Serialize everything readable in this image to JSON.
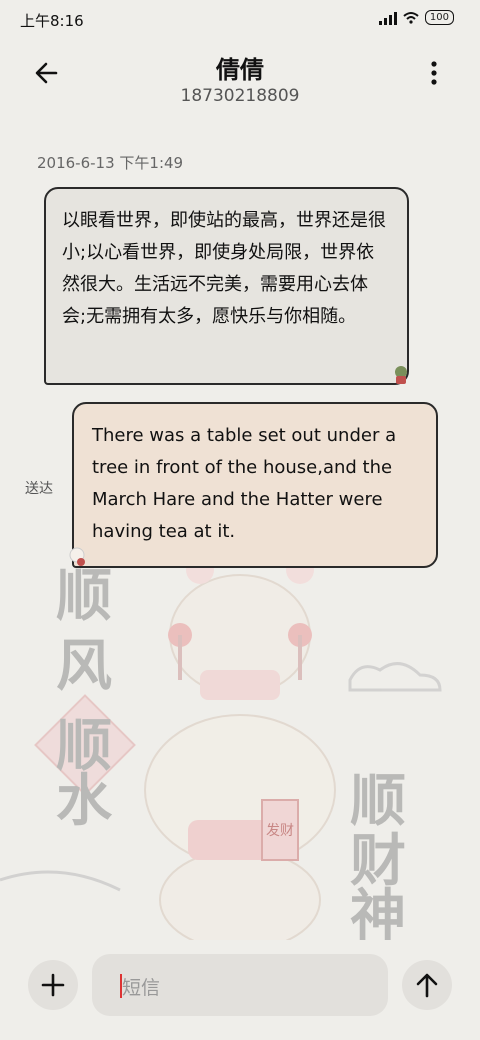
{
  "status_bar": {
    "time": "上午8:16",
    "battery": "100"
  },
  "header": {
    "contact_name": "倩倩",
    "phone_number": "18730218809"
  },
  "conversation": {
    "timestamp": "2016-6-13 下午1:49",
    "messages": [
      {
        "direction": "incoming",
        "text": "以眼看世界，即使站的最高，世界还是很小;以心看世界，即使身处局限，世界依然很大。生活远不完美，需要用心去体会;无需拥有太多，愿快乐与你相随。"
      },
      {
        "direction": "outgoing",
        "text": "There was a table set out under a tree in front of the house,and the March Hare and the Hatter were having tea at it.",
        "status": "送达"
      }
    ]
  },
  "background_art": {
    "left_text": [
      "顺",
      "风",
      "顺",
      "水"
    ],
    "right_text": [
      "顺",
      "财",
      "神"
    ],
    "badge": "发财"
  },
  "composer": {
    "placeholder": "短信"
  }
}
